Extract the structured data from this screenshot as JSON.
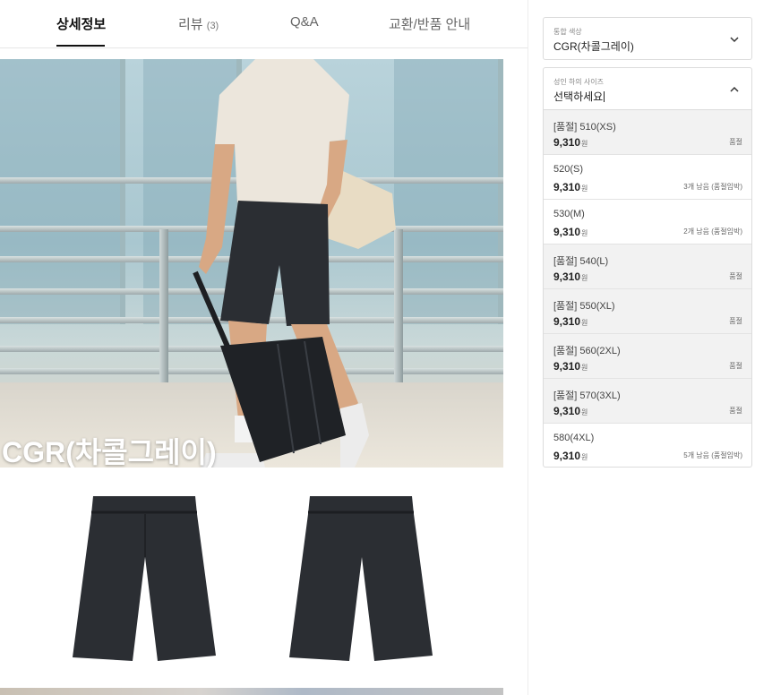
{
  "tabs": [
    {
      "label": "상세정보",
      "count": ""
    },
    {
      "label": "리뷰",
      "count": "(3)"
    },
    {
      "label": "Q&A",
      "count": ""
    },
    {
      "label": "교환/반품 안내",
      "count": ""
    }
  ],
  "hero": {
    "overlay_text": "CGR(차콜그레이)"
  },
  "color_select": {
    "label": "통합 색상",
    "value": "CGR(차콜그레이)"
  },
  "size_select": {
    "label": "성인 하의 사이즈",
    "placeholder": "선택하세요",
    "options": [
      {
        "name": "[품절] 510(XS)",
        "price": "9,310",
        "unit": "원",
        "status": "품절"
      },
      {
        "name": "520(S)",
        "price": "9,310",
        "unit": "원",
        "status": "3개 남음 (품절임박)"
      },
      {
        "name": "530(M)",
        "price": "9,310",
        "unit": "원",
        "status": "2개 남음 (품절임박)"
      },
      {
        "name": "[품절] 540(L)",
        "price": "9,310",
        "unit": "원",
        "status": "품절"
      },
      {
        "name": "[품절] 550(XL)",
        "price": "9,310",
        "unit": "원",
        "status": "품절"
      },
      {
        "name": "[품절] 560(2XL)",
        "price": "9,310",
        "unit": "원",
        "status": "품절"
      },
      {
        "name": "[품절] 570(3XL)",
        "price": "9,310",
        "unit": "원",
        "status": "품절"
      },
      {
        "name": "580(4XL)",
        "price": "9,310",
        "unit": "원",
        "status": "5개 남음 (품절임박)"
      }
    ]
  },
  "colors": {
    "shorts": "#2b2e33",
    "soldout_bg": "#f2f2f2",
    "active_tab": "#111111"
  }
}
